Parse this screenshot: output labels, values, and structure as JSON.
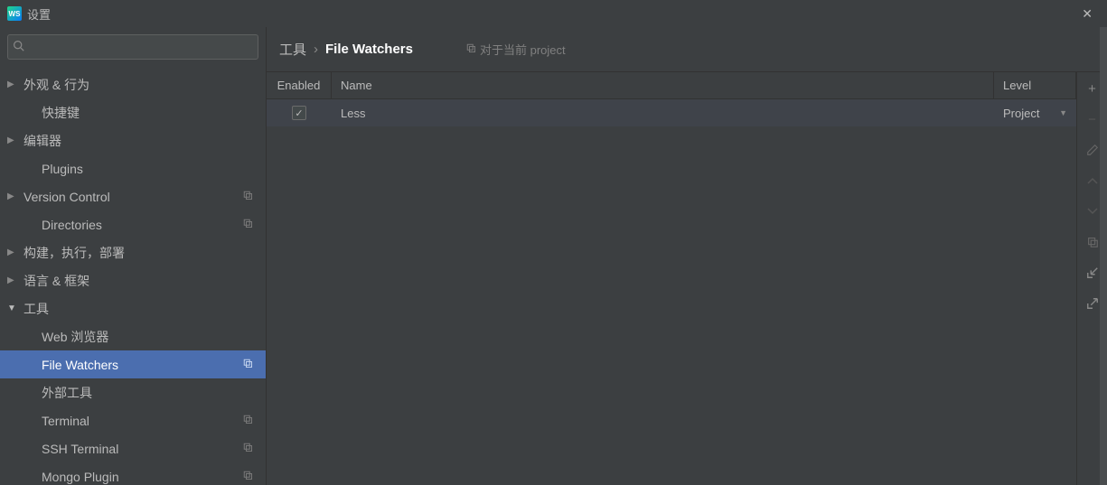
{
  "title": "设置",
  "app_icon_text": "WS",
  "search": {
    "placeholder": ""
  },
  "sidebar": {
    "items": [
      {
        "label": "外观 & 行为",
        "type": "parent",
        "expanded": false,
        "badge": false
      },
      {
        "label": "快捷键",
        "type": "child",
        "badge": false
      },
      {
        "label": "编辑器",
        "type": "parent",
        "expanded": false,
        "badge": false
      },
      {
        "label": "Plugins",
        "type": "child",
        "badge": false
      },
      {
        "label": "Version Control",
        "type": "parent",
        "expanded": false,
        "badge": true
      },
      {
        "label": "Directories",
        "type": "child",
        "badge": true
      },
      {
        "label": "构建，执行，部署",
        "type": "parent",
        "expanded": false,
        "badge": false
      },
      {
        "label": "语言 & 框架",
        "type": "parent",
        "expanded": false,
        "badge": false
      },
      {
        "label": "工具",
        "type": "parent",
        "expanded": true,
        "badge": false
      },
      {
        "label": "Web 浏览器",
        "type": "child",
        "badge": false
      },
      {
        "label": "File Watchers",
        "type": "child",
        "badge": true,
        "selected": true
      },
      {
        "label": "外部工具",
        "type": "child",
        "badge": false
      },
      {
        "label": "Terminal",
        "type": "child",
        "badge": true
      },
      {
        "label": "SSH Terminal",
        "type": "child",
        "badge": true
      },
      {
        "label": "Mongo Plugin",
        "type": "child",
        "badge": true
      }
    ]
  },
  "breadcrumb": {
    "parent": "工具",
    "current": "File Watchers",
    "scope": "对于当前 project"
  },
  "table": {
    "headers": {
      "enabled": "Enabled",
      "name": "Name",
      "level": "Level"
    },
    "rows": [
      {
        "enabled": true,
        "name": "Less",
        "level": "Project"
      }
    ]
  },
  "toolbar": {
    "add": "+",
    "remove": "−",
    "edit": "✎",
    "up": "▲",
    "down": "▼",
    "copy": "⧉",
    "import": "↙",
    "export": "↗"
  }
}
